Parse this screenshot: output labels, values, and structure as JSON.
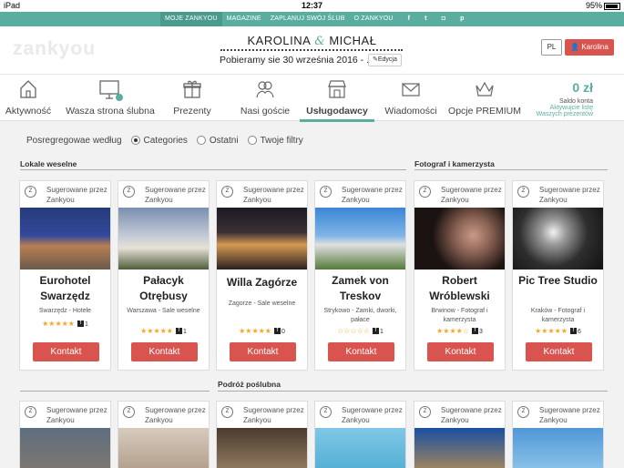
{
  "status_bar": {
    "device": "iPad",
    "time": "12:37",
    "battery": "95%",
    "battery_level": 0.95
  },
  "top_nav": {
    "items": [
      "MOJE ZANKYOU",
      "MAGAZINE",
      "ZAPLANUJ SWÓJ ŚLUB",
      "O ZANKYOU"
    ],
    "social": [
      "f",
      "t",
      "◘",
      "p"
    ]
  },
  "header": {
    "logo": "zankyou",
    "name_left": "KAROLINA",
    "ampersand": "&",
    "name_right": "MICHAŁ",
    "subtitle": "Pobieramy sie 30 września 2016 - ...",
    "edit_label": "Edycja",
    "lang": "PL",
    "user": "Karolina"
  },
  "main_nav": {
    "items": [
      {
        "label": "Aktywność",
        "icon": "home-icon"
      },
      {
        "label": "Wasza strona ślubna",
        "icon": "monitor-icon"
      },
      {
        "label": "Prezenty",
        "icon": "gift-icon"
      },
      {
        "label": "Nasi goście",
        "icon": "guests-icon"
      },
      {
        "label": "Usługodawcy",
        "icon": "shop-icon"
      },
      {
        "label": "Wiadomości",
        "icon": "envelope-icon"
      },
      {
        "label": "Opcje PREMIUM",
        "icon": "crown-icon"
      }
    ],
    "active": "Usługodawcy",
    "saldo": {
      "value": "0 zł",
      "label": "Saldo konta",
      "link1": "Aktywujcie listę",
      "link2": "Waszych prezentów"
    }
  },
  "filters": {
    "label": "Posregregowae według",
    "options": [
      "Categories",
      "Ostatni",
      "Twoje filtry"
    ],
    "selected": "Categories"
  },
  "sections": [
    "Lokale weselne",
    "Fotograf i kamerzysta",
    "Podróż poślubna"
  ],
  "cards": [
    {
      "badge": "Z",
      "tag": "Sugerowane przez Zankyou",
      "title": "Eurohotel Swarzędz",
      "location": "Swarzędz - Hotele",
      "stars": "★★★★★",
      "fb": "1",
      "button": "Kontakt"
    },
    {
      "badge": "Z",
      "tag": "Sugerowane przez Zankyou",
      "title": "Pałacyk Otrębusy",
      "location": "Warszawa - Sale weselne",
      "stars": "★★★★★",
      "fb": "1",
      "button": "Kontakt"
    },
    {
      "badge": "Z",
      "tag": "Sugerowane przez Zankyou",
      "title": "Willa Zagórze",
      "location": "Zagorze - Sale weselne",
      "stars": "★★★★★",
      "fb": "0",
      "button": "Kontakt"
    },
    {
      "badge": "Z",
      "tag": "Sugerowane przez Zankyou",
      "title": "Zamek von Treskov",
      "location": "Strykowo - Zamki, dworki, pałace",
      "stars": "☆☆☆☆☆",
      "fb": "1",
      "button": "Kontakt"
    },
    {
      "badge": "Z",
      "tag": "Sugerowane przez Zankyou",
      "title": "Robert Wróblewski",
      "location": "Brwinow - Fotograf i kamerzysta",
      "stars": "★★★★☆",
      "fb": "3",
      "button": "Kontakt"
    },
    {
      "badge": "Z",
      "tag": "Sugerowane przez Zankyou",
      "title": "Pic Tree Studio",
      "location": "Kraków - Fotograf i kamerzysta",
      "stars": "★★★★★",
      "fb": "6",
      "button": "Kontakt"
    }
  ],
  "cards_row2": [
    {
      "badge": "Z",
      "tag": "Sugerowane przez Zankyou"
    },
    {
      "badge": "Z",
      "tag": "Sugerowane przez Zankyou"
    },
    {
      "badge": "Z",
      "tag": "Sugerowane przez Zankyou"
    },
    {
      "badge": "Z",
      "tag": "Sugerowane przez Zankyou"
    },
    {
      "badge": "Z",
      "tag": "Sugerowane przez Zankyou"
    },
    {
      "badge": "Z",
      "tag": "Sugerowane przez Zankyou"
    }
  ],
  "colors": {
    "accent": "#5aaea0",
    "button": "#d9534f"
  }
}
